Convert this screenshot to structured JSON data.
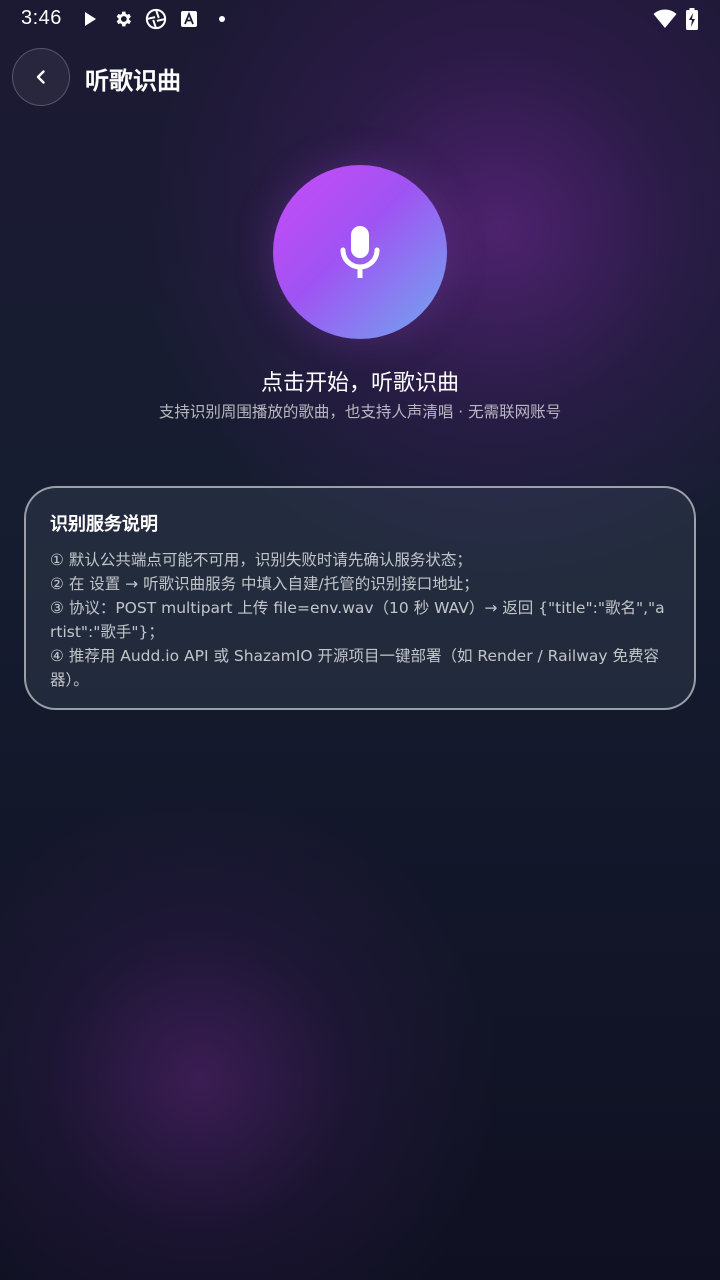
{
  "status_bar": {
    "time": "3:46",
    "icons_left": [
      "play-icon",
      "settings-gear-icon",
      "shutter-icon",
      "font-a-icon",
      "dot-icon"
    ],
    "icons_right": [
      "wifi-icon",
      "battery-charging-icon"
    ]
  },
  "header": {
    "back_icon": "chevron-left-icon",
    "title": "听歌识曲"
  },
  "recognizer": {
    "mic_icon": "microphone-icon",
    "title": "点击开始，听歌识曲",
    "subtitle": "支持识别周围播放的歌曲，也支持人声清唱 · 无需联网账号"
  },
  "info_card": {
    "title": "识别服务说明",
    "lines": [
      "① 默认公共端点可能不可用，识别失败时请先确认服务状态；",
      "② 在 设置 → 听歌识曲服务 中填入自建/托管的识别接口地址；",
      "③ 协议：POST multipart 上传 file=env.wav（10 秒 WAV）→ 返回 {\"title\":\"歌名\",\"artist\":\"歌手\"}；",
      "④ 推荐用 Audd.io API 或 ShazamIO 开源项目一键部署（如 Render / Railway 免费容器）。"
    ]
  },
  "colors": {
    "mic_gradient_start": "#c94bf7",
    "mic_gradient_end": "#6eaaee",
    "background_top": "#1c1933",
    "background_bottom": "#0f1122"
  }
}
